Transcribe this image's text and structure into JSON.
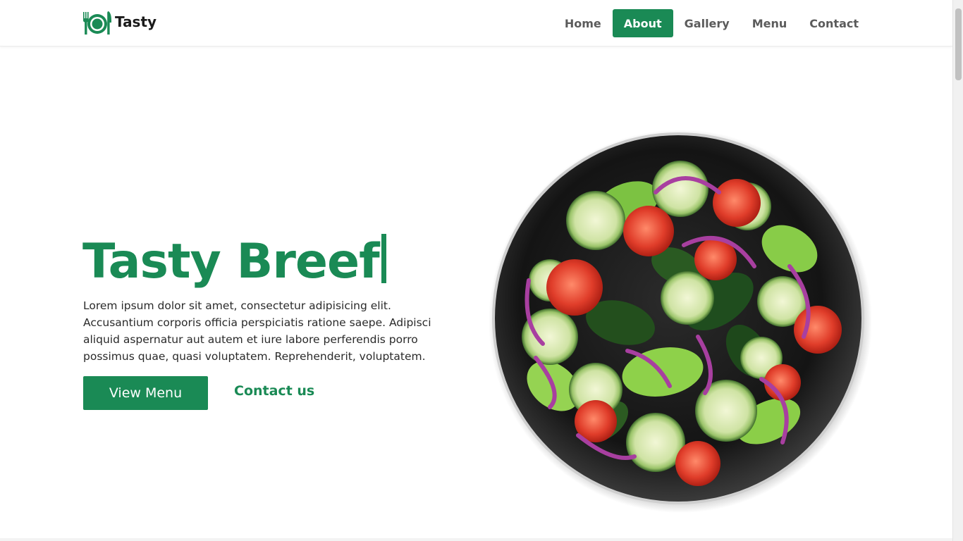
{
  "brand": {
    "name": "Tasty",
    "icon": "plate-cutlery-icon"
  },
  "nav": {
    "items": [
      {
        "label": "Home",
        "active": false
      },
      {
        "label": "About",
        "active": true
      },
      {
        "label": "Gallery",
        "active": false
      },
      {
        "label": "Menu",
        "active": false
      },
      {
        "label": "Contact",
        "active": false
      }
    ]
  },
  "hero": {
    "title": "Tasty Breef",
    "text": "Lorem ipsum dolor sit amet, consectetur adipisicing elit. Accusantium corporis officia perspiciatis ratione saepe. Adipisci aliquid aspernatur aut autem et iure labore perferendis porro possimus quae, quasi voluptatem. Reprehenderit, voluptatem.",
    "primary_button": "View Menu",
    "secondary_link": "Contact us",
    "image": "salad-bowl-image"
  },
  "colors": {
    "accent": "#1a8a55",
    "nav_text": "#5b5b5b"
  }
}
